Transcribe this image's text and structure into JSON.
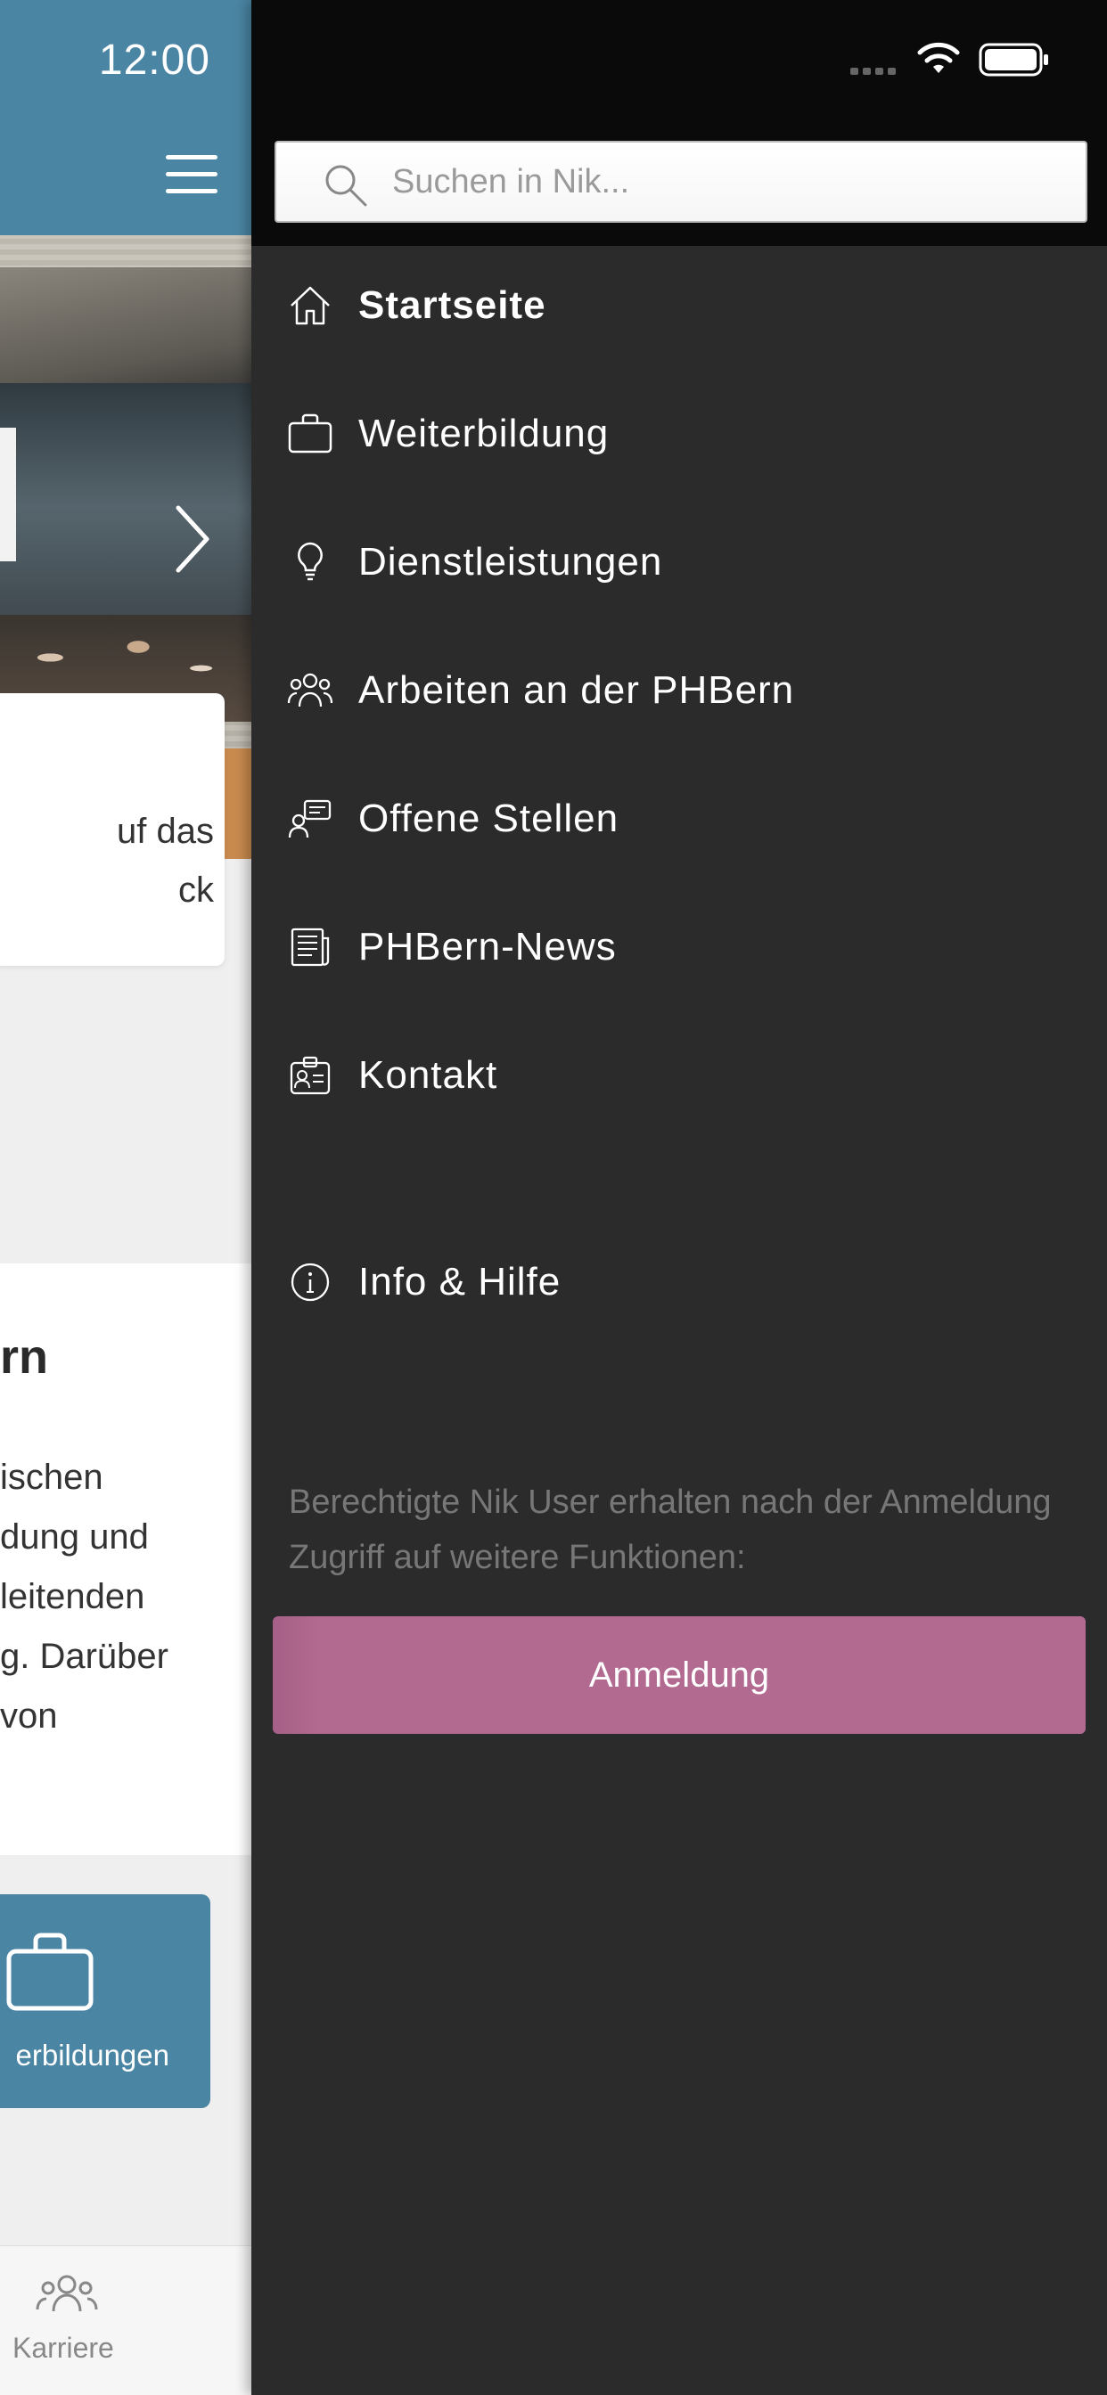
{
  "status_bar": {
    "time": "12:00"
  },
  "search": {
    "placeholder": "Suchen in Nik..."
  },
  "nav": {
    "items": [
      {
        "label": "Startseite",
        "icon": "home-icon",
        "active": true
      },
      {
        "label": "Weiterbildung",
        "icon": "briefcase-icon"
      },
      {
        "label": "Dienstleistungen",
        "icon": "lightbulb-icon"
      },
      {
        "label": "Arbeiten an der PHBern",
        "icon": "people-group-icon"
      },
      {
        "label": "Offene Stellen",
        "icon": "job-chat-icon"
      },
      {
        "label": "PHBern-News",
        "icon": "newspaper-icon"
      },
      {
        "label": "Kontakt",
        "icon": "contact-card-icon"
      }
    ],
    "info": {
      "label": "Info & Hilfe",
      "icon": "info-icon"
    }
  },
  "login": {
    "hint": "Berechtigte Nik User erhalten nach der Anmeldung Zugriff auf weitere Funktionen:",
    "button_label": "Anmeldung"
  },
  "background_app": {
    "card_text": "uf das\nck",
    "section_title": "rn",
    "section_text": "ischen\ndung und\nleitenden\ng. Darüber\nvon",
    "tile_label": "erbildungen",
    "tab_label": "Karriere"
  },
  "colors": {
    "header_blue": "#4a85a3",
    "drawer_bg": "#2b2b2b",
    "login_button": "#b26a90"
  }
}
